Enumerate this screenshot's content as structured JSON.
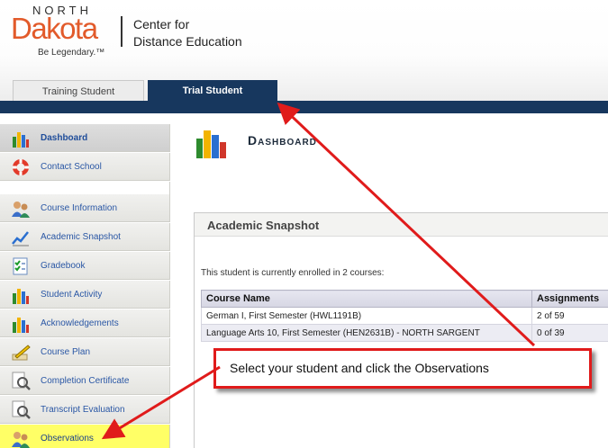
{
  "header": {
    "logo_north": "NORTH",
    "logo_dakota": "Dakota",
    "logo_tagline": "Be Legendary.™",
    "center_line1": "Center for",
    "center_line2": "Distance Education"
  },
  "tabs": [
    {
      "label": "Training Student",
      "active": false
    },
    {
      "label": "Trial Student",
      "active": true
    }
  ],
  "sidebar": {
    "items": [
      {
        "label": "Dashboard",
        "icon": "bar-chart-icon",
        "active": true
      },
      {
        "label": "Contact School",
        "icon": "lifebuoy-icon"
      },
      {
        "label": "Course Information",
        "icon": "people-icon"
      },
      {
        "label": "Academic Snapshot",
        "icon": "line-chart-icon"
      },
      {
        "label": "Gradebook",
        "icon": "checklist-icon"
      },
      {
        "label": "Student Activity",
        "icon": "bar-chart-icon"
      },
      {
        "label": "Acknowledgements",
        "icon": "bar-chart-icon"
      },
      {
        "label": "Course Plan",
        "icon": "pencil-icon"
      },
      {
        "label": "Completion Certificate",
        "icon": "magnifier-icon"
      },
      {
        "label": "Transcript Evaluation",
        "icon": "magnifier-icon"
      },
      {
        "label": "Observations",
        "icon": "people-icon",
        "highlighted": true
      }
    ]
  },
  "main": {
    "page_title": "Dashboard",
    "panel_title": "Academic Snapshot",
    "enrolled_text": "This student is currently enrolled in 2 courses:",
    "table": {
      "headers": [
        "Course Name",
        "Assignments"
      ],
      "rows": [
        [
          "German I, First Semester (HWL1191B)",
          "2 of 59"
        ],
        [
          "Language Arts 10, First Semester (HEN2631B) - NORTH SARGENT",
          "0 of 39"
        ]
      ]
    }
  },
  "callout": {
    "text": "Select your student and click the Observations"
  },
  "colors": {
    "brand_navy": "#17375e",
    "logo_orange": "#e25a2a",
    "callout_red": "#e01b1b",
    "highlight_yellow": "#ffff66"
  }
}
